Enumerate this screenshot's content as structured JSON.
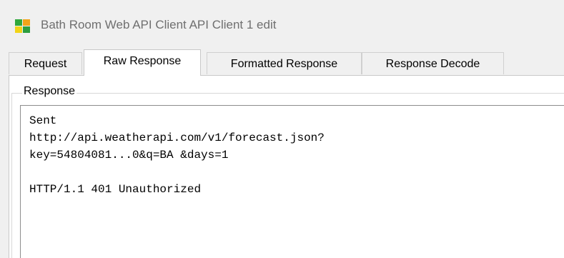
{
  "window": {
    "title": "Bath Room Web API Client API Client 1 edit",
    "icon": "app-tile-icon",
    "icon_colors": [
      "#2fa83c",
      "#f2a419",
      "#f1d417",
      "#2d9e3f"
    ]
  },
  "tabs": [
    {
      "label": "Request",
      "active": false
    },
    {
      "label": "Raw Response",
      "active": true
    },
    {
      "label": "Formatted Response",
      "active": false
    },
    {
      "label": "Response Decode",
      "active": false
    }
  ],
  "panel": {
    "group_label": "Response",
    "response_lines": [
      "Sent",
      "http://api.weatherapi.com/v1/forecast.json?",
      "key=54804081...0&q=BA &days=1",
      "",
      "HTTP/1.1 401 Unauthorized"
    ]
  }
}
